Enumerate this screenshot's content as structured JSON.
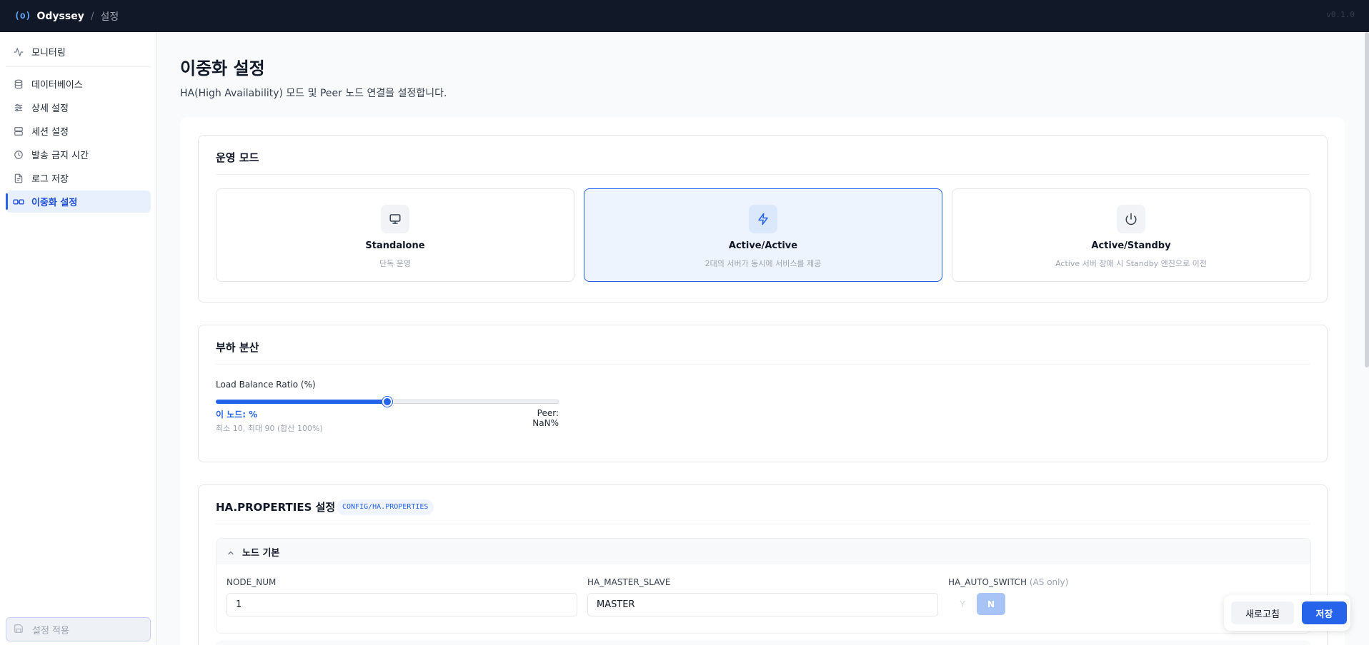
{
  "topbar": {
    "logo_mark": "(o)",
    "brand": "Odyssey",
    "separator": "/",
    "crumb": "설정",
    "version": "v0.1.0"
  },
  "sidebar": {
    "items": [
      {
        "label": "모니터링",
        "icon": "activity-icon"
      },
      {
        "label": "데이터베이스",
        "icon": "database-icon"
      },
      {
        "label": "상세 설정",
        "icon": "sliders-icon"
      },
      {
        "label": "세션 설정",
        "icon": "server-icon"
      },
      {
        "label": "발송 금지 시간",
        "icon": "clock-icon"
      },
      {
        "label": "로그 저장",
        "icon": "file-icon"
      },
      {
        "label": "이중화 설정",
        "icon": "link-icon",
        "active": true
      }
    ],
    "apply_label": "설정 적용"
  },
  "page": {
    "title": "이중화 설정",
    "subtitle": "HA(High Availability) 모드 및 Peer 노드 연결을 설정합니다."
  },
  "mode": {
    "title": "운영 모드",
    "options": [
      {
        "name": "Standalone",
        "desc": "단독 운영",
        "icon": "monitor-icon"
      },
      {
        "name": "Active/Active",
        "desc": "2대의 서버가 동시에 서비스를 제공",
        "icon": "zap-icon",
        "selected": true
      },
      {
        "name": "Active/Standby",
        "desc": "Active 서버 장애 시 Standby 엔진으로 이전",
        "icon": "power-icon"
      }
    ]
  },
  "load_balance": {
    "title": "부하 분산",
    "label": "Load Balance Ratio (%)",
    "value_fraction": 0.5,
    "node_text": "이 노드: %",
    "peer_text": "Peer: NaN%",
    "hint": "최소 10, 최대 90 (합산 100%)"
  },
  "ha_props": {
    "title": "HA.PROPERTIES 설정",
    "tag": "CONFIG/HA.PROPERTIES",
    "section_title": "노드 기본",
    "fields": {
      "node_num": {
        "label": "NODE_NUM",
        "value": "1"
      },
      "master_slave": {
        "label": "HA_MASTER_SLAVE",
        "value": "MASTER"
      },
      "auto_switch": {
        "label": "HA_AUTO_SWITCH",
        "note": "(AS only)",
        "y": "Y",
        "n": "N",
        "selected": "N"
      }
    }
  },
  "actions": {
    "refresh": "새로고침",
    "save": "저장"
  },
  "colors": {
    "accent": "#2563eb",
    "topbar": "#111827",
    "selected_bg": "#eef4fe"
  }
}
